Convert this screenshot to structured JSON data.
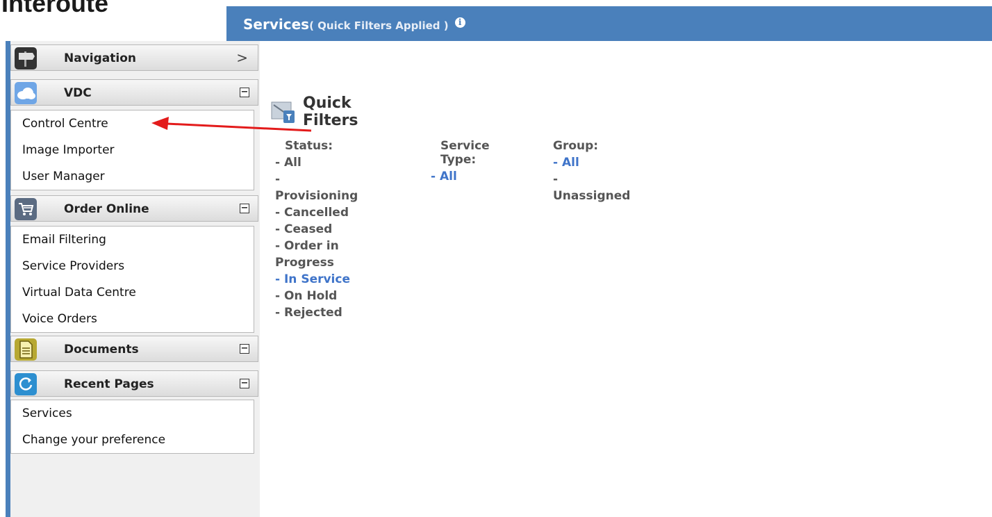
{
  "brand": {
    "logo_text": "Interoute"
  },
  "title_bar": {
    "title": "Services",
    "subtitle": "( Quick Filters Applied )",
    "info_icon": "info-icon"
  },
  "sidebar": {
    "navigation": {
      "label": "Navigation",
      "icon": "signpost-icon"
    },
    "vdc": {
      "label": "VDC",
      "icon": "cloud-icon",
      "items": [
        "Control Centre",
        "Image Importer",
        "User Manager"
      ]
    },
    "order_online": {
      "label": "Order Online",
      "icon": "cart-icon",
      "items": [
        "Email Filtering",
        "Service Providers",
        "Virtual Data Centre",
        "Voice Orders"
      ]
    },
    "documents": {
      "label": "Documents",
      "icon": "document-icon"
    },
    "recent_pages": {
      "label": "Recent Pages",
      "icon": "refresh-icon",
      "items": [
        "Services",
        "Change your preference"
      ]
    }
  },
  "quick_filters": {
    "title": "Quick Filters",
    "status": {
      "label": "Status:",
      "options": [
        "- All",
        "- Provisioning",
        "- Cancelled",
        "- Ceased",
        "- Order in Progress",
        "- In Service",
        "- On Hold",
        "- Rejected"
      ],
      "active": "- In Service"
    },
    "service_type": {
      "label": "Service Type:",
      "options": [
        "- All"
      ],
      "active": "- All"
    },
    "group": {
      "label": "Group:",
      "options": [
        "- All",
        "- Unassigned"
      ],
      "active": "- All"
    }
  },
  "colors": {
    "header_blue": "#4a80bb",
    "link_blue": "#3f74c9",
    "annotation_red": "#e31b1b"
  }
}
